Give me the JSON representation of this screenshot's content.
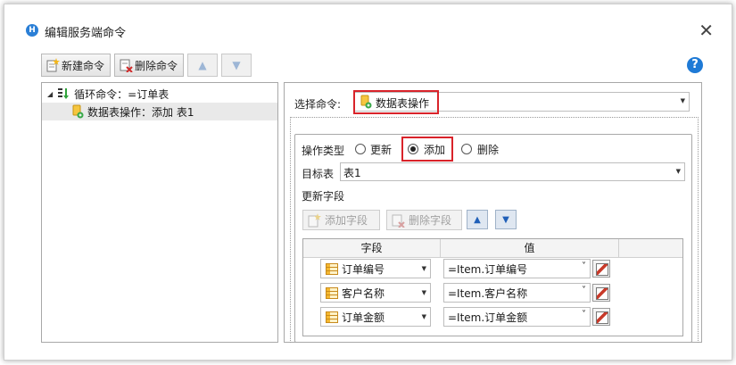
{
  "window": {
    "title": "编辑服务端命令",
    "app_icon_letter": "H",
    "close_glyph": "✕"
  },
  "toolbar": {
    "new_label": "新建命令",
    "delete_label": "删除命令",
    "up_glyph": "▲",
    "down_glyph": "▼",
    "help_glyph": "?"
  },
  "tree": {
    "items": [
      {
        "expander": "◢",
        "label": "循环命令：=订单表"
      },
      {
        "label": "数据表操作：添加 表1"
      }
    ]
  },
  "command": {
    "label": "选择命令:",
    "selected": "数据表操作"
  },
  "operation": {
    "label": "操作类型",
    "options": [
      "更新",
      "添加",
      "删除"
    ],
    "selected": "添加"
  },
  "target": {
    "label": "目标表",
    "value": "表1"
  },
  "fields_section": {
    "label": "更新字段",
    "add_label": "添加字段",
    "delete_label": "删除字段",
    "up_glyph": "▲",
    "down_glyph": "▼"
  },
  "grid": {
    "headers": [
      "字段",
      "值"
    ],
    "rows": [
      {
        "field": "订单编号",
        "value": "=Item.订单编号"
      },
      {
        "field": "客户名称",
        "value": "=Item.客户名称"
      },
      {
        "field": "订单金额",
        "value": "=Item.订单金额"
      }
    ]
  },
  "colors": {
    "highlight": "#d9232a",
    "accent": "#1e7ad6"
  }
}
